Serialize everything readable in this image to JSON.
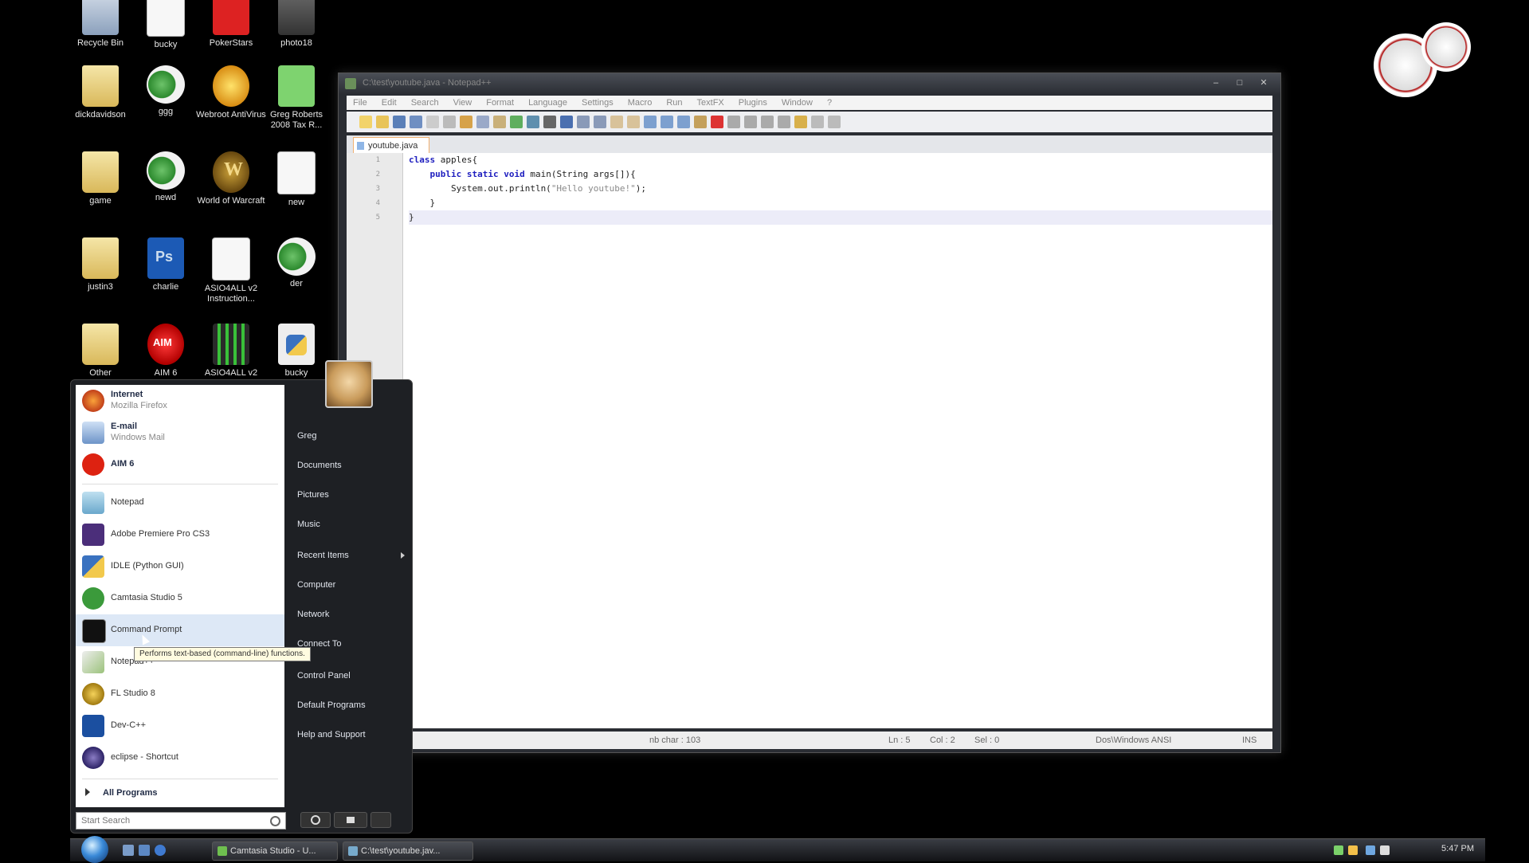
{
  "desktop": {
    "icons": [
      {
        "label": "Recycle Bin",
        "icon": "recycle-bin-icon"
      },
      {
        "label": "bucky",
        "icon": "document-icon"
      },
      {
        "label": "PokerStars",
        "icon": "pokerstars-icon"
      },
      {
        "label": "photo18",
        "icon": "photo-icon"
      },
      {
        "label": "dickdavidson",
        "icon": "folder-icon"
      },
      {
        "label": "ggg",
        "icon": "camtasia-file-icon"
      },
      {
        "label": "Webroot AntiVirus",
        "icon": "webroot-icon"
      },
      {
        "label": "Greg Roberts 2008 Tax R...",
        "icon": "spreadsheet-icon"
      },
      {
        "label": "game",
        "icon": "folder-icon"
      },
      {
        "label": "newd",
        "icon": "camtasia-file-icon"
      },
      {
        "label": "World of Warcraft",
        "icon": "warcraft-icon"
      },
      {
        "label": "new",
        "icon": "blank-document-icon"
      },
      {
        "label": "justin3",
        "icon": "folder-icon"
      },
      {
        "label": "charlie",
        "icon": "photoshop-file-icon"
      },
      {
        "label": "ASIO4ALL v2 Instruction...",
        "icon": "pdf-icon"
      },
      {
        "label": "der",
        "icon": "camtasia-file-icon"
      },
      {
        "label": "Other",
        "icon": "folder-icon"
      },
      {
        "label": "AIM 6",
        "icon": "aim-icon"
      },
      {
        "label": "ASIO4ALL v2",
        "icon": "asio-icon"
      },
      {
        "label": "bucky",
        "icon": "python-file-icon"
      }
    ]
  },
  "notepad": {
    "title": "C:\\test\\youtube.java - Notepad++",
    "window_controls": [
      "–",
      "□",
      "✕"
    ],
    "menu": [
      "File",
      "Edit",
      "Search",
      "View",
      "Format",
      "Language",
      "Settings",
      "Macro",
      "Run",
      "TextFX",
      "Plugins",
      "Window",
      "?"
    ],
    "tab": "youtube.java",
    "line_numbers": [
      "1",
      "2",
      "3",
      "4",
      "5"
    ],
    "code": {
      "l1_kw": "class",
      "l1_rest": " apples{",
      "l2_indent": "    ",
      "l2_kw": "public static void",
      "l2_rest": " main(String args[]){",
      "l3_pre": "        System.out.println(",
      "l3_str": "\"Hello youtube!\"",
      "l3_post": ");",
      "l4": "    }",
      "l5": "}"
    },
    "status": {
      "nb_char": "nb char : 103",
      "ln": "Ln : 5",
      "col": "Col : 2",
      "sel": "Sel : 0",
      "format": "Dos\\Windows  ANSI",
      "mode": "INS"
    }
  },
  "start_menu": {
    "pinned": [
      {
        "title": "Internet",
        "subtitle": "Mozilla Firefox"
      },
      {
        "title": "E-mail",
        "subtitle": "Windows Mail"
      },
      {
        "title": "AIM 6",
        "subtitle": ""
      }
    ],
    "recent": [
      "Notepad",
      "Adobe Premiere Pro CS3",
      "IDLE (Python GUI)",
      "Camtasia Studio 5",
      "Command Prompt",
      "Notepad++",
      "FL Studio 8",
      "Dev-C++",
      "eclipse - Shortcut"
    ],
    "all_programs": "All Programs",
    "search_placeholder": "Start Search",
    "tooltip": "Performs text-based (command-line) functions.",
    "right_items": [
      "Greg",
      "Documents",
      "Pictures",
      "Music",
      "Recent Items",
      "Computer",
      "Network",
      "Connect To",
      "Control Panel",
      "Default Programs",
      "Help and Support"
    ]
  },
  "taskbar": {
    "buttons": [
      "Camtasia Studio - U...",
      "C:\\test\\youtube.jav..."
    ],
    "clock": "5:47 PM"
  },
  "colors": {
    "keyword": "#1e1ebf",
    "string": "#8a8a8a",
    "highlight_row": "#dde8f6"
  }
}
